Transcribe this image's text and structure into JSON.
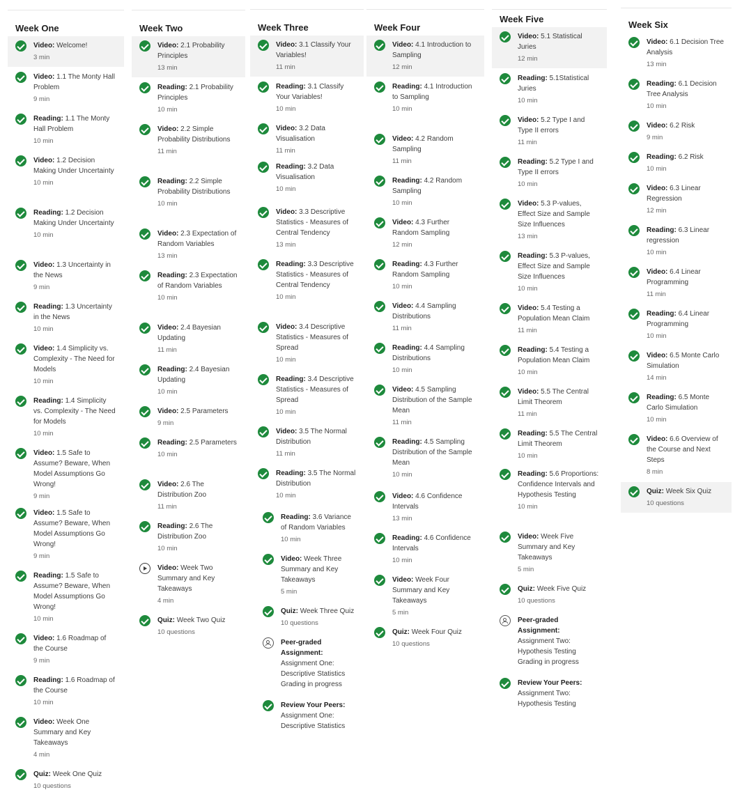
{
  "labels": {
    "video": "Video:",
    "reading": "Reading:",
    "quiz": "Quiz:"
  },
  "weeks": [
    {
      "title": "Week One",
      "items": [
        {
          "type": "video",
          "title": "Welcome!",
          "meta": "3 min"
        },
        {
          "type": "video",
          "title": "1.1 The Monty Hall Problem",
          "meta": "9 min"
        },
        {
          "type": "reading",
          "title": "1.1 The Monty Hall Problem",
          "meta": "10 min"
        },
        {
          "type": "video",
          "title": "1.2 Decision Making Under Uncertainty",
          "meta": "10 min"
        },
        {
          "type": "reading",
          "title": "1.2 Decision Making Under Uncertainty",
          "meta": "10 min"
        },
        {
          "type": "video",
          "title": "1.3 Uncertainty in the News",
          "meta": "9 min"
        },
        {
          "type": "reading",
          "title": "1.3 Uncertainty in the News",
          "meta": "10 min"
        },
        {
          "type": "video",
          "title": "1.4 Simplicity vs. Complexity - The Need for Models",
          "meta": "10 min"
        },
        {
          "type": "reading",
          "title": "1.4 Simplicity vs. Complexity - The Need for Models",
          "meta": "10 min"
        },
        {
          "type": "video",
          "title": "1.5 Safe to Assume? Beware, When Model Assumptions Go Wrong!",
          "meta": "9 min"
        },
        {
          "type": "video",
          "title": "1.5 Safe to Assume? Beware, When Model Assumptions Go Wrong!",
          "meta": "9 min"
        },
        {
          "type": "reading",
          "title": "1.5 Safe to Assume? Beware, When Model Assumptions Go Wrong!",
          "meta": "10 min"
        },
        {
          "type": "video",
          "title": "1.6 Roadmap of the Course",
          "meta": "9 min"
        },
        {
          "type": "reading",
          "title": "1.6 Roadmap of the Course",
          "meta": "10 min"
        },
        {
          "type": "video",
          "title": "Week One Summary and Key Takeaways",
          "meta": "4 min"
        },
        {
          "type": "quiz",
          "title": "Week One Quiz",
          "meta": "10 questions"
        }
      ]
    },
    {
      "title": "Week Two",
      "items": [
        {
          "type": "video",
          "title": "2.1 Probability Principles",
          "meta": "13 min"
        },
        {
          "type": "reading",
          "title": "2.1 Probability Principles",
          "meta": "10 min"
        },
        {
          "type": "video",
          "title": "2.2 Simple Probability Distributions",
          "meta": "11 min"
        },
        {
          "type": "reading",
          "title": "2.2 Simple Probability Distributions",
          "meta": "10 min"
        },
        {
          "type": "video",
          "title": "2.3 Expectation of Random Variables",
          "meta": "13 min"
        },
        {
          "type": "reading",
          "title": "2.3 Expectation of Random Variables",
          "meta": "10 min"
        },
        {
          "type": "video",
          "title": "2.4 Bayesian Updating",
          "meta": "11 min"
        },
        {
          "type": "reading",
          "title": "2.4 Bayesian Updating",
          "meta": "10 min"
        },
        {
          "type": "video",
          "title": "2.5 Parameters",
          "meta": "9 min"
        },
        {
          "type": "reading",
          "title": "2.5 Parameters",
          "meta": "10 min"
        },
        {
          "type": "video",
          "title": "2.6 The Distribution Zoo",
          "meta": "11 min"
        },
        {
          "type": "reading",
          "title": "2.6 The Distribution Zoo",
          "meta": "10 min"
        },
        {
          "type": "video",
          "title": "Week Two Summary and Key Takeaways",
          "meta": "4 min",
          "status": "play"
        },
        {
          "type": "quiz",
          "title": "Week Two Quiz",
          "meta": "10 questions"
        }
      ]
    },
    {
      "title": "Week Three",
      "items": [
        {
          "type": "video",
          "title": "3.1 Classify Your Variables!",
          "meta": "11 min"
        },
        {
          "type": "reading",
          "title": "3.1 Classify Your Variables!",
          "meta": "10 min"
        },
        {
          "type": "video",
          "title": "3.2 Data Visualisation",
          "meta": "11 min"
        },
        {
          "type": "reading",
          "title": "3.2 Data Visualisation",
          "meta": "10 min"
        },
        {
          "type": "video",
          "title": "3.3 Descriptive Statistics - Measures of Central Tendency",
          "meta": "13 min"
        },
        {
          "type": "reading",
          "title": "3.3 Descriptive Statistics - Measures of Central Tendency",
          "meta": "10 min"
        },
        {
          "type": "video",
          "title": "3.4 Descriptive Statistics - Measures of Spread",
          "meta": "10 min"
        },
        {
          "type": "reading",
          "title": "3.4 Descriptive Statistics - Measures of Spread",
          "meta": "10 min"
        },
        {
          "type": "video",
          "title": "3.5 The Normal Distribution",
          "meta": "11 min"
        },
        {
          "type": "reading",
          "title": "3.5 The Normal Distribution",
          "meta": "10 min"
        },
        {
          "type": "reading",
          "title": "3.6 Variance of Random Variables",
          "meta": "10 min"
        },
        {
          "type": "video",
          "title": "Week Three Summary and Key Takeaways",
          "meta": "5 min"
        },
        {
          "type": "quiz",
          "title": "Week Three Quiz",
          "meta": "10 questions"
        },
        {
          "type": "peer",
          "heading": "Peer-graded Assignment:",
          "title": "Assignment One: Descriptive Statistics",
          "meta": "Grading in progress",
          "status": "peer"
        },
        {
          "type": "review",
          "heading": "Review Your Peers:",
          "title": "Assignment One: Descriptive Statistics",
          "meta": ""
        }
      ]
    },
    {
      "title": "Week Four",
      "items": [
        {
          "type": "video",
          "title": "4.1 Introduction to Sampling",
          "meta": "12 min"
        },
        {
          "type": "reading",
          "title": "4.1 Introduction to Sampling",
          "meta": "10 min"
        },
        {
          "type": "video",
          "title": "4.2 Random Sampling",
          "meta": "11 min"
        },
        {
          "type": "reading",
          "title": "4.2 Random Sampling",
          "meta": "10 min"
        },
        {
          "type": "video",
          "title": "4.3 Further Random Sampling",
          "meta": "12 min"
        },
        {
          "type": "reading",
          "title": "4.3 Further Random Sampling",
          "meta": "10 min"
        },
        {
          "type": "video",
          "title": "4.4 Sampling Distributions",
          "meta": "11 min"
        },
        {
          "type": "reading",
          "title": "4.4 Sampling Distributions",
          "meta": "10 min"
        },
        {
          "type": "video",
          "title": "4.5 Sampling Distribution of the Sample Mean",
          "meta": "11 min"
        },
        {
          "type": "reading",
          "title": "4.5 Sampling Distribution of the Sample Mean",
          "meta": "10 min"
        },
        {
          "type": "video",
          "title": "4.6 Confidence Intervals",
          "meta": "13 min"
        },
        {
          "type": "reading",
          "title": "4.6 Confidence Intervals",
          "meta": "10 min"
        },
        {
          "type": "video",
          "title": "Week Four Summary and Key Takeaways",
          "meta": "5 min"
        },
        {
          "type": "quiz",
          "title": "Week Four Quiz",
          "meta": "10 questions"
        }
      ]
    },
    {
      "title": "Week Five",
      "items": [
        {
          "type": "video",
          "title": "5.1 Statistical Juries",
          "meta": "12 min"
        },
        {
          "type": "reading",
          "title": "5.1Statistical Juries",
          "meta": "10 min"
        },
        {
          "type": "video",
          "title": "5.2 Type I and Type II errors",
          "meta": "11 min"
        },
        {
          "type": "reading",
          "title": "5.2 Type I and Type II errors",
          "meta": "10 min"
        },
        {
          "type": "video",
          "title": "5.3 P-values, Effect Size and Sample Size Influences",
          "meta": "13 min"
        },
        {
          "type": "reading",
          "title": "5.3 P-values, Effect Size and Sample Size Influences",
          "meta": "10 min"
        },
        {
          "type": "video",
          "title": "5.4 Testing a Population Mean Claim",
          "meta": "11 min"
        },
        {
          "type": "reading",
          "title": "5.4 Testing a Population Mean Claim",
          "meta": "10 min"
        },
        {
          "type": "video",
          "title": "5.5 The Central Limit Theorem",
          "meta": "11 min"
        },
        {
          "type": "reading",
          "title": "5.5 The Central Limit Theorem",
          "meta": "10 min"
        },
        {
          "type": "reading",
          "title": "5.6 Proportions: Confidence Intervals and Hypothesis Testing",
          "meta": "10 min"
        },
        {
          "type": "video",
          "title": "Week Five Summary and Key Takeaways",
          "meta": "5 min"
        },
        {
          "type": "quiz",
          "title": "Week Five Quiz",
          "meta": "10 questions"
        },
        {
          "type": "peer",
          "heading": "Peer-graded Assignment:",
          "title": "Assignment Two: Hypothesis Testing",
          "meta": "Grading in progress",
          "status": "peer"
        },
        {
          "type": "review",
          "heading": "Review Your Peers:",
          "title": "Assignment Two: Hypothesis Testing",
          "meta": ""
        }
      ]
    },
    {
      "title": "Week Six",
      "items": [
        {
          "type": "video",
          "title": "6.1 Decision Tree Analysis",
          "meta": "13 min"
        },
        {
          "type": "reading",
          "title": "6.1 Decision Tree Analysis",
          "meta": "10 min"
        },
        {
          "type": "video",
          "title": "6.2 Risk",
          "meta": "9 min"
        },
        {
          "type": "reading",
          "title": "6.2 Risk",
          "meta": "10 min"
        },
        {
          "type": "video",
          "title": "6.3 Linear Regression",
          "meta": "12 min"
        },
        {
          "type": "reading",
          "title": "6.3 Linear regression",
          "meta": "10 min"
        },
        {
          "type": "video",
          "title": "6.4 Linear Programming",
          "meta": "11 min"
        },
        {
          "type": "reading",
          "title": "6.4 Linear Programming",
          "meta": "10 min"
        },
        {
          "type": "video",
          "title": "6.5 Monte Carlo Simulation",
          "meta": "14 min"
        },
        {
          "type": "reading",
          "title": "6.5 Monte Carlo Simulation",
          "meta": "10 min"
        },
        {
          "type": "video",
          "title": "6.6 Overview of the Course and Next Steps",
          "meta": "8 min"
        },
        {
          "type": "quiz",
          "title": "Week Six Quiz",
          "meta": "10 questions"
        }
      ]
    }
  ]
}
